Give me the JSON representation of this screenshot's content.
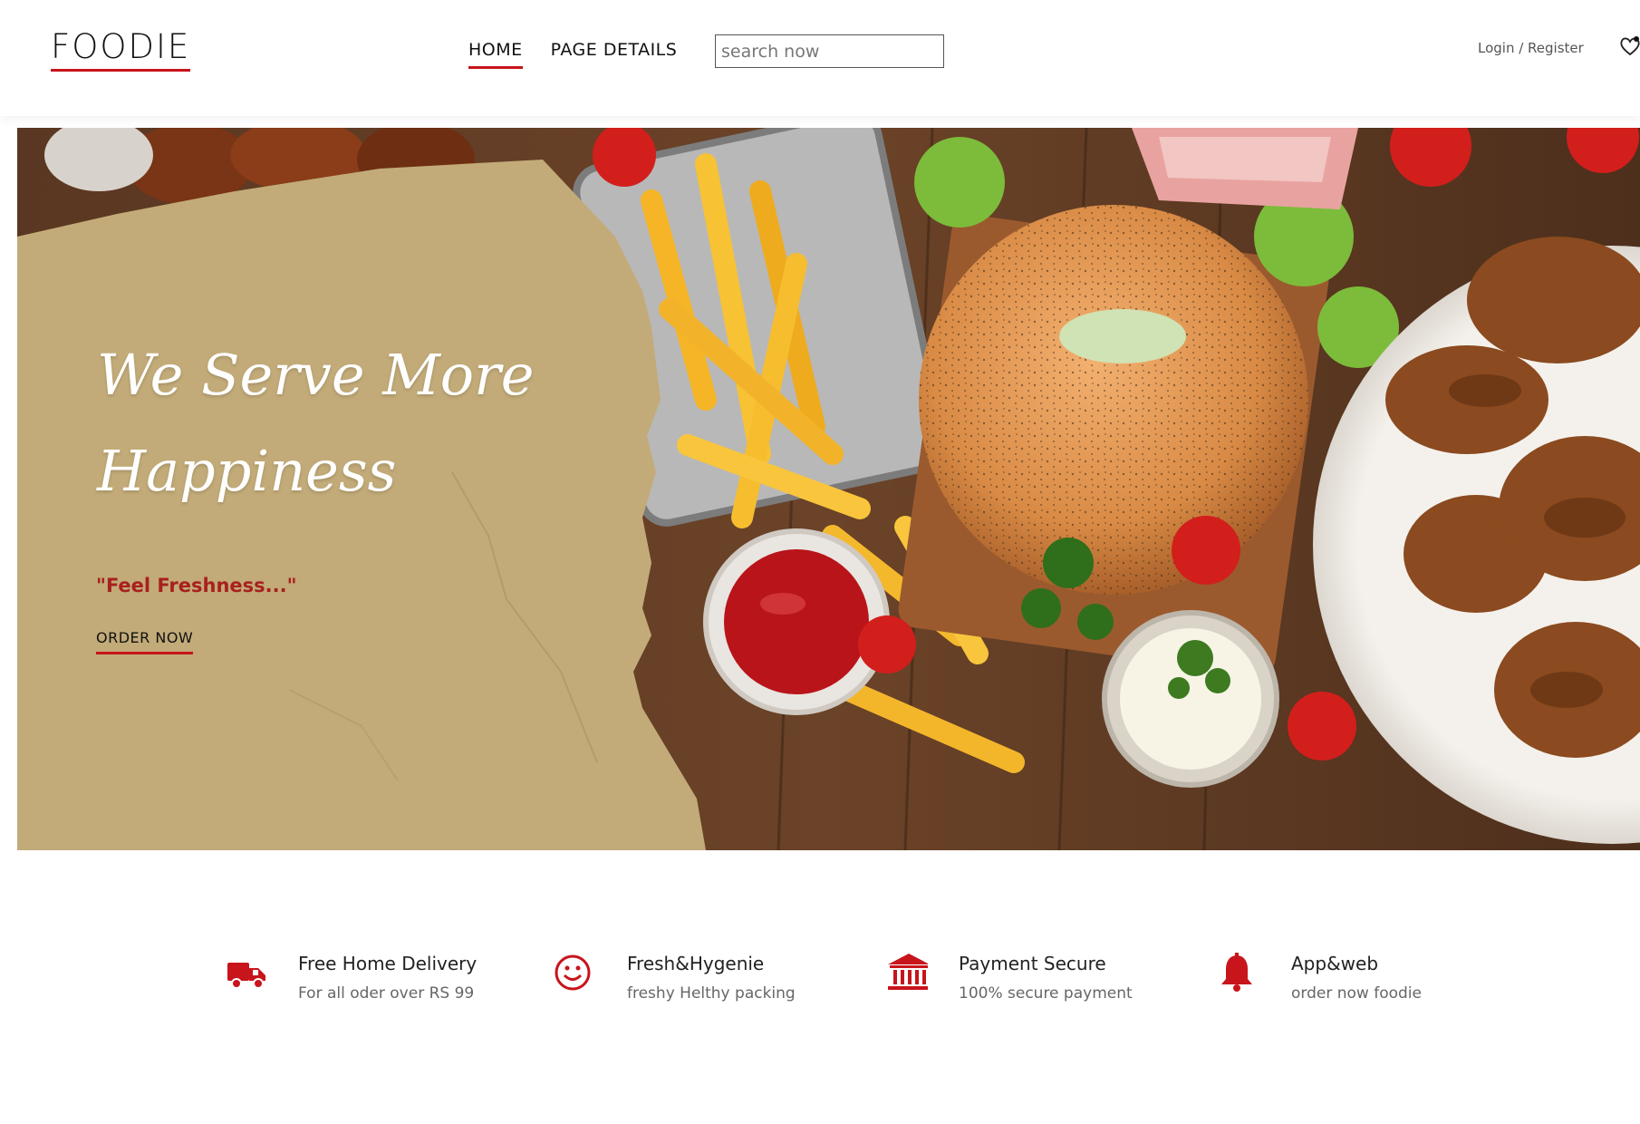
{
  "header": {
    "logo": "FOODIE",
    "nav": [
      {
        "label": "HOME",
        "active": true
      },
      {
        "label": "PAGE DETAILS",
        "active": false
      }
    ],
    "search_placeholder": "search now",
    "auth": "Login / Register"
  },
  "hero": {
    "title_line1": "We Serve More",
    "title_line2": "Happiness",
    "tagline": "\"Feel Freshness...\"",
    "cta": "ORDER NOW"
  },
  "features": [
    {
      "icon": "truck-icon",
      "title": "Free Home Delivery",
      "subtitle": "For all oder over RS 99"
    },
    {
      "icon": "smiley-icon",
      "title": "Fresh&Hygenie",
      "subtitle": "freshy Helthy packing"
    },
    {
      "icon": "bank-icon",
      "title": "Payment Secure",
      "subtitle": "100% secure payment"
    },
    {
      "icon": "bell-icon",
      "title": "App&web",
      "subtitle": "order now foodie"
    }
  ],
  "colors": {
    "accent": "#c8141b",
    "paper": "#c2ab78",
    "wood": "#4a2e1d"
  }
}
